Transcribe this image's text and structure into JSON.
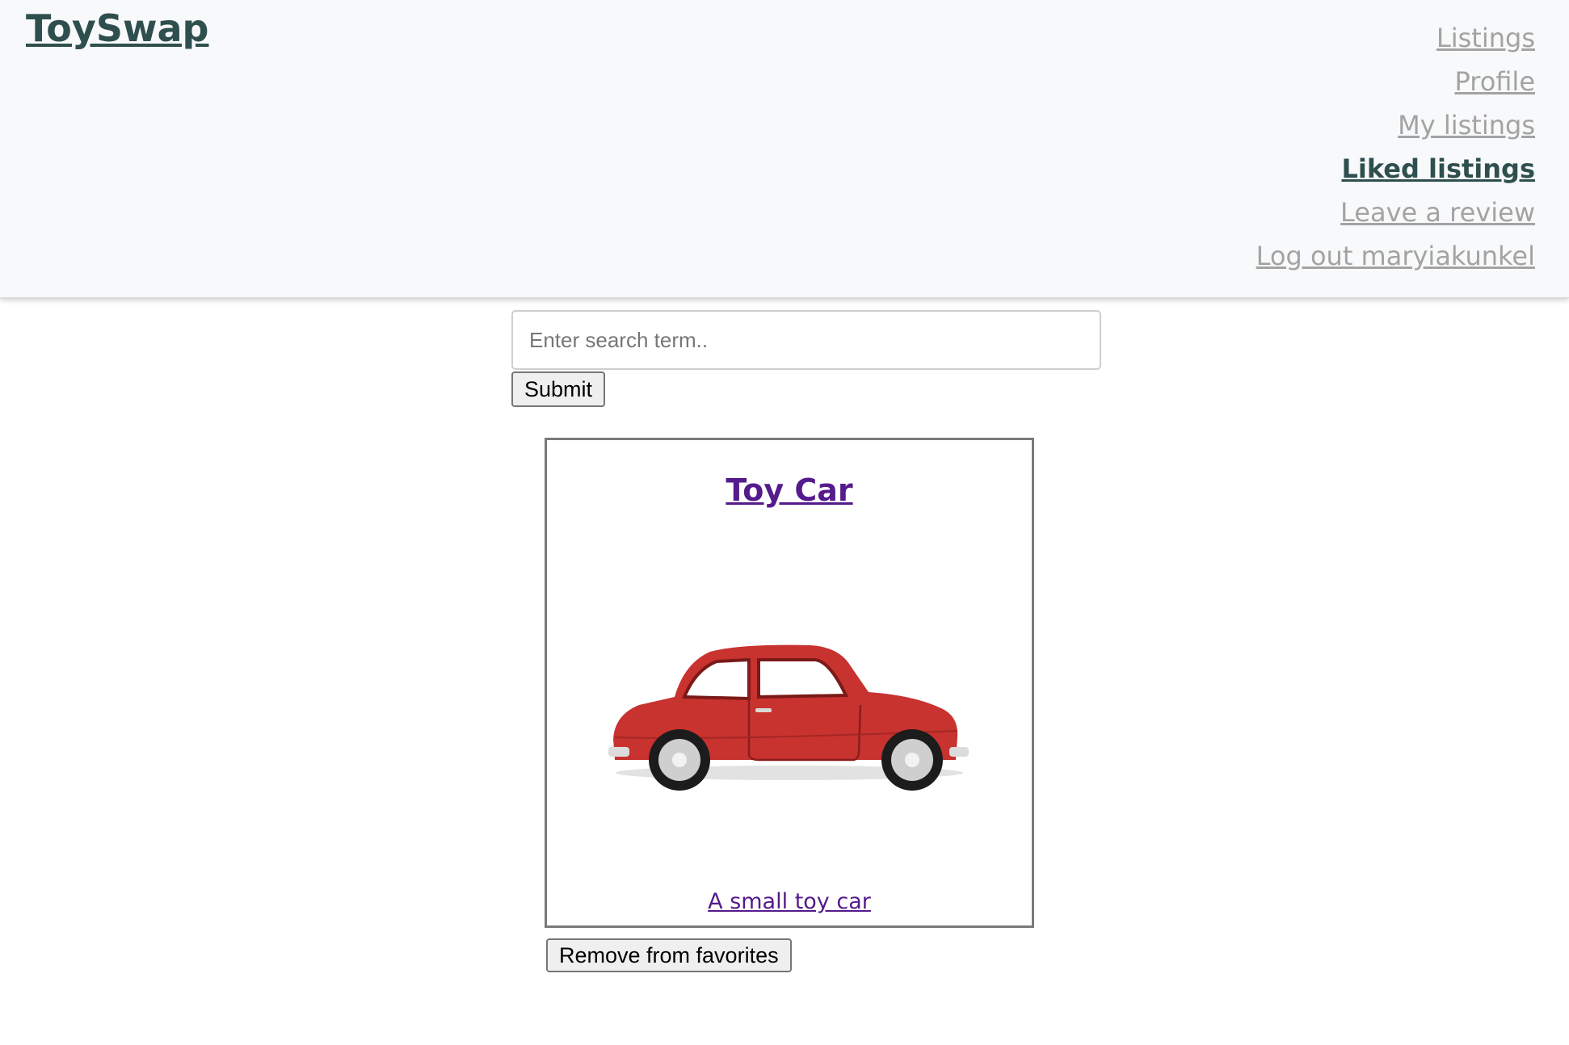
{
  "header": {
    "brand": "ToySwap",
    "nav": [
      {
        "label": "Listings",
        "active": false
      },
      {
        "label": "Profile",
        "active": false
      },
      {
        "label": "My listings",
        "active": false
      },
      {
        "label": "Liked listings",
        "active": true
      },
      {
        "label": "Leave a review",
        "active": false
      },
      {
        "label": "Log out maryiakunkel",
        "active": false
      }
    ]
  },
  "search": {
    "placeholder": "Enter search term..",
    "value": "",
    "submit_label": "Submit"
  },
  "listing": {
    "title": "Toy Car",
    "image_icon": "red-toy-car-image",
    "description": "A small toy car",
    "remove_label": "Remove from favorites"
  },
  "colors": {
    "brand": "#2f4f4f",
    "nav_inactive": "#a3a3a3",
    "link_visited": "#551a8b",
    "navbar_bg": "#f8f9fa",
    "car_red": "#c8322f"
  }
}
